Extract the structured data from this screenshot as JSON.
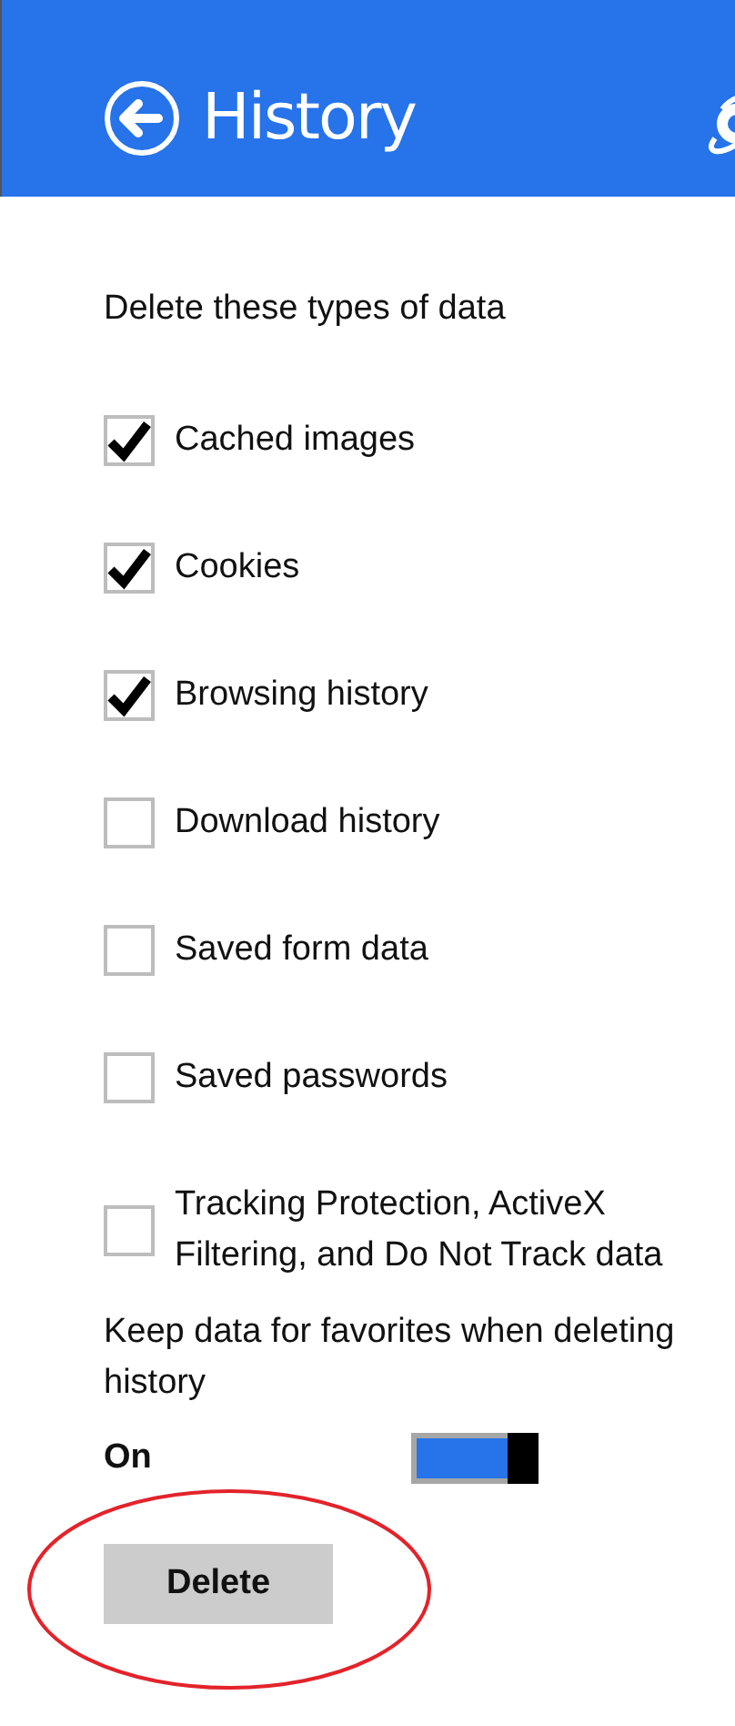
{
  "header": {
    "title": "History"
  },
  "section_label": "Delete these types of data",
  "options": [
    {
      "label": "Cached images",
      "checked": true
    },
    {
      "label": "Cookies",
      "checked": true
    },
    {
      "label": "Browsing history",
      "checked": true
    },
    {
      "label": "Download history",
      "checked": false
    },
    {
      "label": "Saved form data",
      "checked": false
    },
    {
      "label": "Saved passwords",
      "checked": false
    },
    {
      "label": "Tracking Protection, ActiveX Filtering, and Do Not Track data",
      "checked": false
    }
  ],
  "keep_favorites": {
    "label": "Keep data for favorites when deleting history",
    "state_text": "On",
    "on": true
  },
  "delete_button": {
    "label": "Delete"
  }
}
